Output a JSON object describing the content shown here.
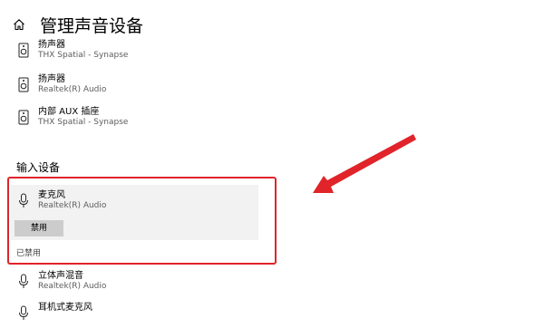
{
  "header": {
    "title": "管理声音设备",
    "icon": "home-icon"
  },
  "output_devices": [
    {
      "name": "扬声器",
      "sub": "THX Spatial - Synapse",
      "icon": "speaker-icon"
    },
    {
      "name": "扬声器",
      "sub": "Realtek(R) Audio",
      "icon": "speaker-icon"
    },
    {
      "name": "内部 AUX 插座",
      "sub": "THX Spatial - Synapse",
      "icon": "speaker-icon"
    }
  ],
  "input_section": {
    "heading": "输入设备",
    "selected_device": {
      "name": "麦克风",
      "sub": "Realtek(R) Audio",
      "icon": "microphone-icon",
      "button_label": "禁用"
    },
    "disabled_status": "已禁用",
    "other_devices": [
      {
        "name": "立体声混音",
        "sub": "Realtek(R) Audio",
        "icon": "microphone-icon"
      },
      {
        "name": "耳机式麦克风",
        "sub": "",
        "icon": "microphone-icon"
      }
    ]
  },
  "colors": {
    "annotation": "#e0242a",
    "card_background": "#f2f2f2",
    "button_background": "#cccccc"
  }
}
